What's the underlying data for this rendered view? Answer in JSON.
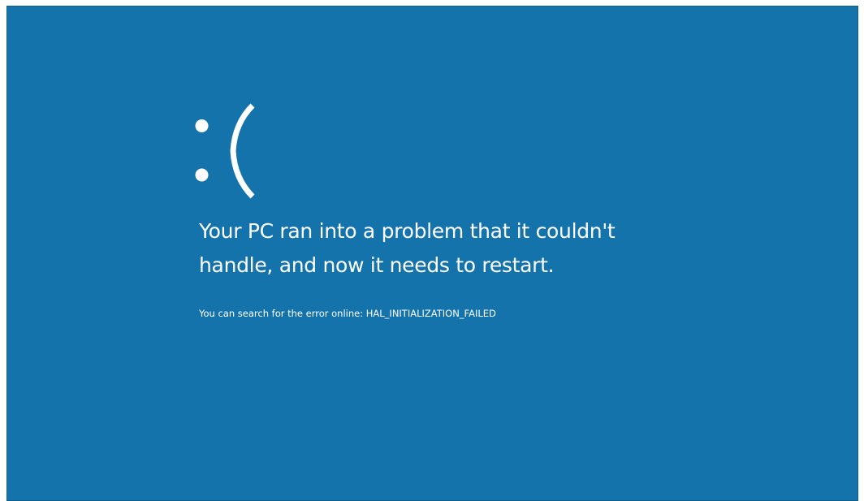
{
  "screen": {
    "background_color": "#1473aa",
    "text_color": "#ffffff",
    "face": ":(",
    "headline_line1": "Your PC ran into a problem that it couldn't",
    "headline_line2": "handle, and now it needs to restart.",
    "search_prefix": "You can search for the error online: ",
    "error_code": "HAL_INITIALIZATION_FAILED"
  }
}
